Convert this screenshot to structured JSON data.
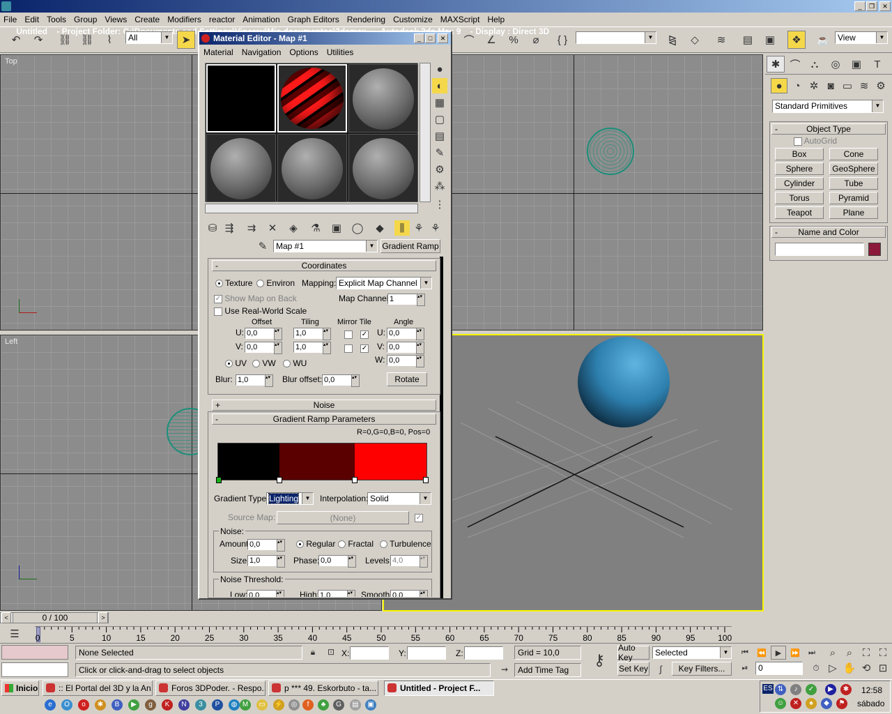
{
  "titlebar": {
    "text": "Untitled    - Project Folder: C:\\Documents and Settings\\Viperey\\Mis documentos\\3dsmax    - Autodesk 3ds Max 9    - Display : Direct 3D"
  },
  "menubar": [
    "File",
    "Edit",
    "Tools",
    "Group",
    "Views",
    "Create",
    "Modifiers",
    "reactor",
    "Animation",
    "Graph Editors",
    "Rendering",
    "Customize",
    "MAXScript",
    "Help"
  ],
  "toolbar": {
    "selection_filter": "All",
    "view_combo": "View"
  },
  "viewports": {
    "top": "Top",
    "left": "Left"
  },
  "material_editor": {
    "title": "Material Editor - Map #1",
    "menu": [
      "Material",
      "Navigation",
      "Options",
      "Utilities"
    ],
    "map_name": "Map #1",
    "map_type_button": "Gradient Ramp",
    "coordinates": {
      "title": "Coordinates",
      "texture": "Texture",
      "environ": "Environ",
      "mapping_label": "Mapping:",
      "mapping_value": "Explicit Map Channel",
      "show_map_on_back": "Show Map on Back",
      "map_channel_label": "Map Channel:",
      "map_channel": "1",
      "real_world": "Use Real-World Scale",
      "offset": "Offset",
      "tiling": "Tiling",
      "mirror_tile": "Mirror Tile",
      "angle": "Angle",
      "u": "U:",
      "v": "V:",
      "w": "W:",
      "u_offset": "0,0",
      "v_offset": "0,0",
      "u_tiling": "1,0",
      "v_tiling": "1,0",
      "u_angle": "0,0",
      "v_angle": "0,0",
      "w_angle": "0,0",
      "uv": "UV",
      "vw": "VW",
      "wu": "WU",
      "blur_label": "Blur:",
      "blur": "1,0",
      "blur_offset_label": "Blur offset:",
      "blur_offset": "0,0",
      "rotate": "Rotate"
    },
    "noise_rollout": "Noise",
    "gradient": {
      "title": "Gradient Ramp Parameters",
      "readout": "R=0,G=0,B=0, Pos=0",
      "type_label": "Gradient Type:",
      "type_value": "Lighting",
      "interp_label": "Interpolation:",
      "interp_value": "Solid",
      "source_map_label": "Source Map:",
      "source_map": "(None)",
      "noise_label": "Noise:",
      "amount_label": "Amount:",
      "amount": "0,0",
      "regular": "Regular",
      "fractal": "Fractal",
      "turbulence": "Turbulence",
      "size_label": "Size:",
      "size": "1,0",
      "phase_label": "Phase:",
      "phase": "0,0",
      "levels_label": "Levels:",
      "levels": "4,0",
      "threshold_label": "Noise Threshold:",
      "low_label": "Low:",
      "low": "0,0",
      "high_label": "High:",
      "high": "1,0",
      "smooth_label": "Smooth:",
      "smooth": "0,0",
      "colors": [
        "#000000",
        "#5a0000",
        "#ff0000"
      ]
    }
  },
  "command_panel": {
    "category": "Standard Primitives",
    "object_type": "Object Type",
    "autogrid": "AutoGrid",
    "buttons": [
      "Box",
      "Cone",
      "Sphere",
      "GeoSphere",
      "Cylinder",
      "Tube",
      "Torus",
      "Pyramid",
      "Teapot",
      "Plane"
    ],
    "name_and_color": "Name and Color",
    "color": "#8b1a3a"
  },
  "timeline": {
    "frame": "0 / 100",
    "ticks": [
      "0",
      "5",
      "10",
      "15",
      "20",
      "25",
      "30",
      "35",
      "40",
      "45",
      "50",
      "55",
      "60",
      "65",
      "70",
      "75",
      "80",
      "85",
      "90",
      "95",
      "100"
    ]
  },
  "status": {
    "selection": "None Selected",
    "prompt": "Click or click-and-drag to select objects",
    "x_label": "X:",
    "y_label": "Y:",
    "z_label": "Z:",
    "grid": "Grid = 10,0",
    "add_time_tag": "Add Time Tag",
    "auto_key": "Auto Key",
    "set_key": "Set Key",
    "selected": "Selected",
    "key_filters": "Key Filters...",
    "frame_field": "0"
  },
  "taskbar": {
    "start": "Inicio",
    "tasks": [
      ":: El Portal del 3D y la An...",
      "Foros 3DPoder. - Respo...",
      "p *** 49. Eskorbuto - ta...",
      "Untitled    - Project F..."
    ],
    "lang": "ES",
    "clock": "12:58",
    "day": "sábado"
  }
}
